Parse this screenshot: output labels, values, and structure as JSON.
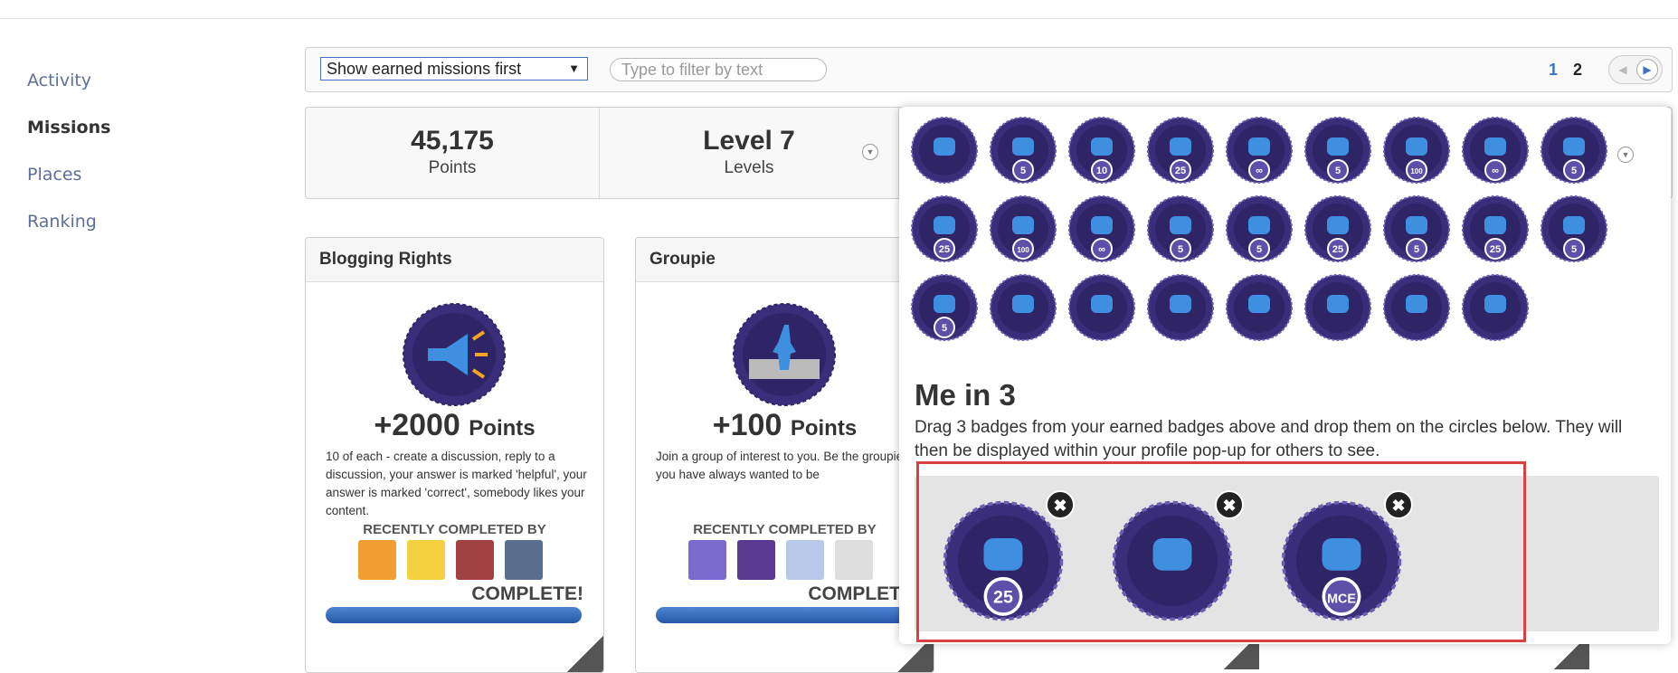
{
  "sidebar": {
    "items": [
      {
        "label": "Activity",
        "active": false
      },
      {
        "label": "Missions",
        "active": true
      },
      {
        "label": "Places",
        "active": false
      },
      {
        "label": "Ranking",
        "active": false
      }
    ]
  },
  "toolbar": {
    "sort_selected": "Show earned missions first",
    "filter_placeholder": "Type to filter by text",
    "pages": [
      "1",
      "2"
    ],
    "current_page": "1"
  },
  "stats": {
    "points": {
      "value": "45,175",
      "label": "Points"
    },
    "levels": {
      "value": "Level 7",
      "label": "Levels"
    }
  },
  "cards": [
    {
      "title": "Blogging Rights",
      "points": "+2000",
      "points_unit": "Points",
      "description": "10 of each - create a discussion, reply to a discussion, your answer is marked 'helpful', your answer is marked 'correct', somebody likes your content.",
      "recent_label": "RECENTLY COMPLETED BY",
      "status": "COMPLETE!",
      "progress": 1.0
    },
    {
      "title": "Groupie",
      "points": "+100",
      "points_unit": "Points",
      "description": "Join a group of interest to you. Be the groupie you have always wanted to be",
      "recent_label": "RECENTLY COMPLETED BY",
      "status": "COMPLETE",
      "progress": 1.0
    }
  ],
  "popup": {
    "title": "Me in 3",
    "description": "Drag 3 badges from your earned badges above and drop them on the circles below. They will then be displayed within your profile pop-up for others to see.",
    "badges": [
      {
        "icon": "megaphone-badge-icon",
        "label": ""
      },
      {
        "icon": "question-5-badge-icon",
        "label": "5"
      },
      {
        "icon": "question-10-badge-icon",
        "label": "10"
      },
      {
        "icon": "question-25-badge-icon",
        "label": "25"
      },
      {
        "icon": "question-infinity-badge-icon",
        "label": "∞"
      },
      {
        "icon": "people-5-badge-icon",
        "label": "5"
      },
      {
        "icon": "crowd-100-badge-icon",
        "label": "100"
      },
      {
        "icon": "crowd-infinity-badge-icon",
        "label": "∞"
      },
      {
        "icon": "chat-5-badge-icon",
        "label": "5"
      },
      {
        "icon": "chat-25-badge-icon",
        "label": "25"
      },
      {
        "icon": "chat-100-badge-icon",
        "label": "100"
      },
      {
        "icon": "chat-infinity-badge-icon",
        "label": "∞"
      },
      {
        "icon": "lightbulb-badge-icon",
        "label": "5"
      },
      {
        "icon": "thumbs-up-5-badge-icon",
        "label": "5"
      },
      {
        "icon": "thumbs-up-25-badge-icon",
        "label": "25"
      },
      {
        "icon": "like-list-5-badge-icon",
        "label": "5"
      },
      {
        "icon": "like-list-25-badge-icon",
        "label": "25"
      },
      {
        "icon": "target-badge-icon",
        "label": "5"
      },
      {
        "icon": "approved-badge-icon",
        "label": "5"
      },
      {
        "icon": "book-badge-icon",
        "label": ""
      },
      {
        "icon": "concert-badge-icon",
        "label": ""
      },
      {
        "icon": "ballot-badge-icon",
        "label": ""
      },
      {
        "icon": "check-cross-badge-icon",
        "label": ""
      },
      {
        "icon": "speech-bubble-badge-icon",
        "label": ""
      },
      {
        "icon": "upload-document-badge-icon",
        "label": ""
      },
      {
        "icon": "tagged-document-badge-icon",
        "label": ""
      }
    ],
    "selected": [
      {
        "icon": "people-25-badge-icon",
        "label": "25"
      },
      {
        "icon": "monitor-image-badge-icon",
        "label": ""
      },
      {
        "icon": "mce-chart-badge-icon",
        "label": "MCE"
      }
    ],
    "remove_glyph": "✖"
  },
  "colors": {
    "badge_dark": "#2e2466",
    "badge_ring": "#3a2e7a",
    "accent": "#3e73c4",
    "highlight": "#d9403f"
  }
}
